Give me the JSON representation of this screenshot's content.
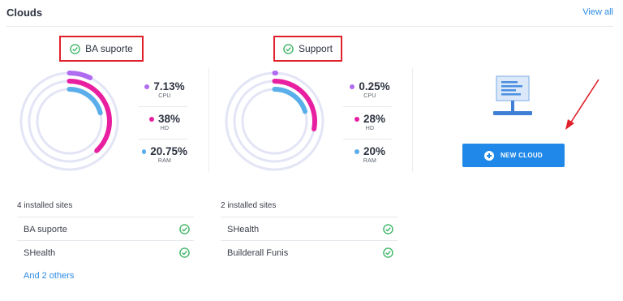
{
  "header": {
    "title": "Clouds",
    "view_all": "View all"
  },
  "colors": {
    "cpu": "#b06cf0",
    "hd": "#e81fa0",
    "ram": "#5aaeea",
    "track": "#e3e5f6",
    "accent": "#1f88e8",
    "success": "#3fb567",
    "annotation": "#e0202a"
  },
  "clouds": [
    {
      "name": "BA suporte",
      "metrics": [
        {
          "value": "7.13%",
          "label": "CPU",
          "fraction": 0.0713
        },
        {
          "value": "38%",
          "label": "HD",
          "fraction": 0.38
        },
        {
          "value": "20.75%",
          "label": "RAM",
          "fraction": 0.2075
        }
      ],
      "installed_label": "4 installed sites",
      "sites": [
        "BA suporte",
        "SHealth"
      ],
      "others_link": "And 2 others"
    },
    {
      "name": "Support",
      "metrics": [
        {
          "value": "0.25%",
          "label": "CPU",
          "fraction": 0.0025
        },
        {
          "value": "28%",
          "label": "HD",
          "fraction": 0.28
        },
        {
          "value": "20%",
          "label": "RAM",
          "fraction": 0.2
        }
      ],
      "installed_label": "2 installed sites",
      "sites": [
        "SHealth",
        "Builderall Funis"
      ]
    }
  ],
  "new_cloud": {
    "button_label": "NEW CLOUD"
  }
}
